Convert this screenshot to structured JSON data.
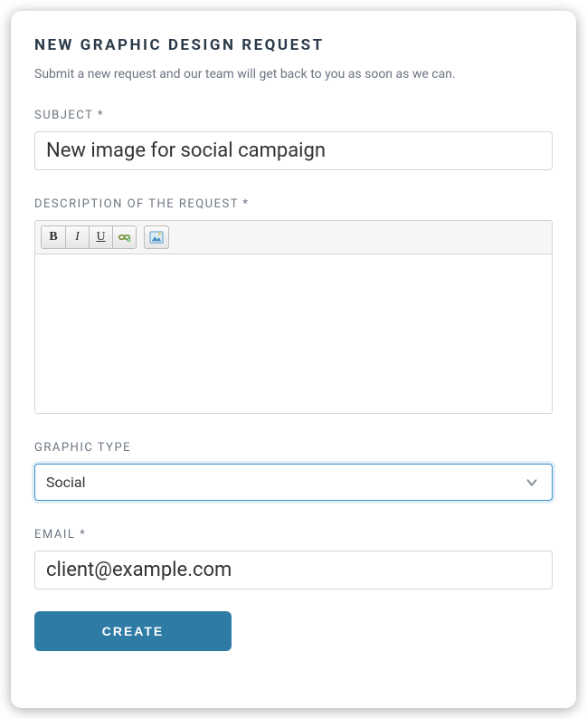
{
  "form": {
    "title": "NEW GRAPHIC DESIGN REQUEST",
    "subtitle": "Submit a new request and our team will get back to you as soon as we can.",
    "subject": {
      "label": "SUBJECT *",
      "value": "New image for social campaign"
    },
    "description": {
      "label": "DESCRIPTION OF THE REQUEST *",
      "value": ""
    },
    "graphic_type": {
      "label": "GRAPHIC TYPE",
      "value": "Social"
    },
    "email": {
      "label": "EMAIL *",
      "value": "client@example.com"
    },
    "submit_label": "CREATE"
  },
  "toolbar": {
    "bold": "B",
    "italic": "I",
    "underline": "U"
  }
}
